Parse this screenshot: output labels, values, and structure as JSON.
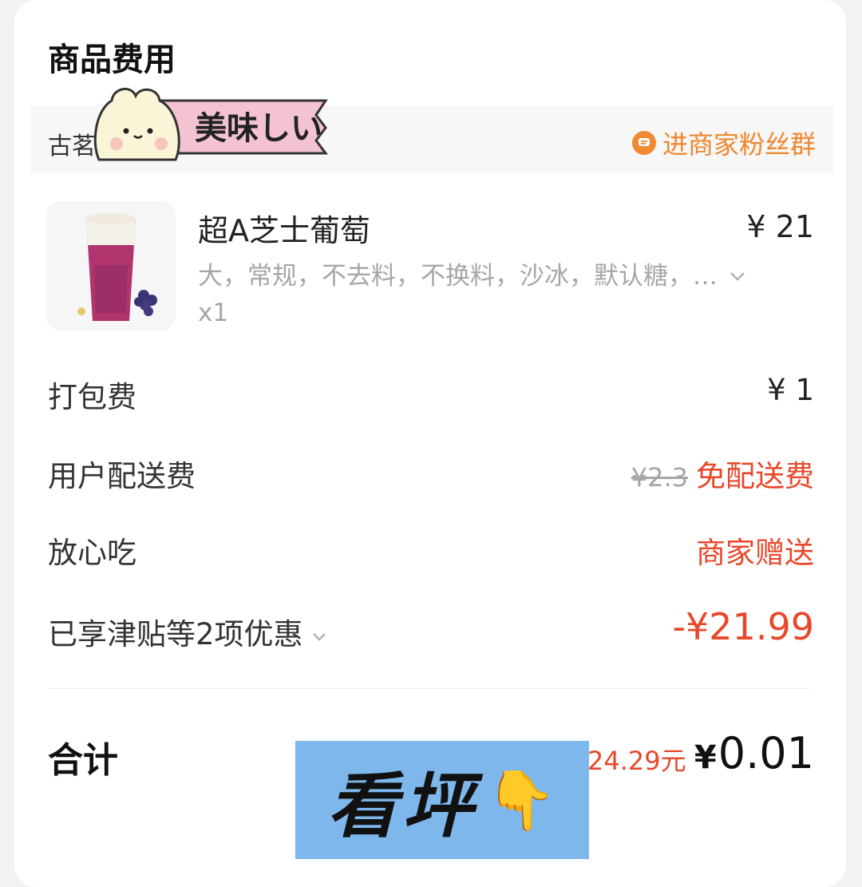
{
  "section_title": "商品费用",
  "shop": {
    "name": "古茗",
    "fan_group_label": "进商家粉丝群"
  },
  "sticker": {
    "text": "美味しい"
  },
  "product": {
    "name": "超A芝士葡萄",
    "price": "¥ 21",
    "spec": "大，常规，不去料，不换料，沙冰，默认糖，…",
    "qty": "x1"
  },
  "fees": {
    "packing_label": "打包费",
    "packing_value": "¥ 1",
    "delivery_label": "用户配送费",
    "delivery_original": "¥2.3",
    "delivery_value": "免配送费",
    "worry_free_label": "放心吃",
    "worry_free_value": "商家赠送",
    "discount_label": "已享津贴等2项优惠",
    "discount_value": "-¥21.99"
  },
  "total": {
    "label": "合计",
    "original": "24.29元",
    "currency": "¥",
    "amount": "0.01"
  },
  "overlay": {
    "text": "看坪",
    "emoji": "👇"
  },
  "colors": {
    "accent_orange": "#f0862c",
    "discount_red": "#e8472a",
    "overlay_blue": "#7eb7ec"
  }
}
